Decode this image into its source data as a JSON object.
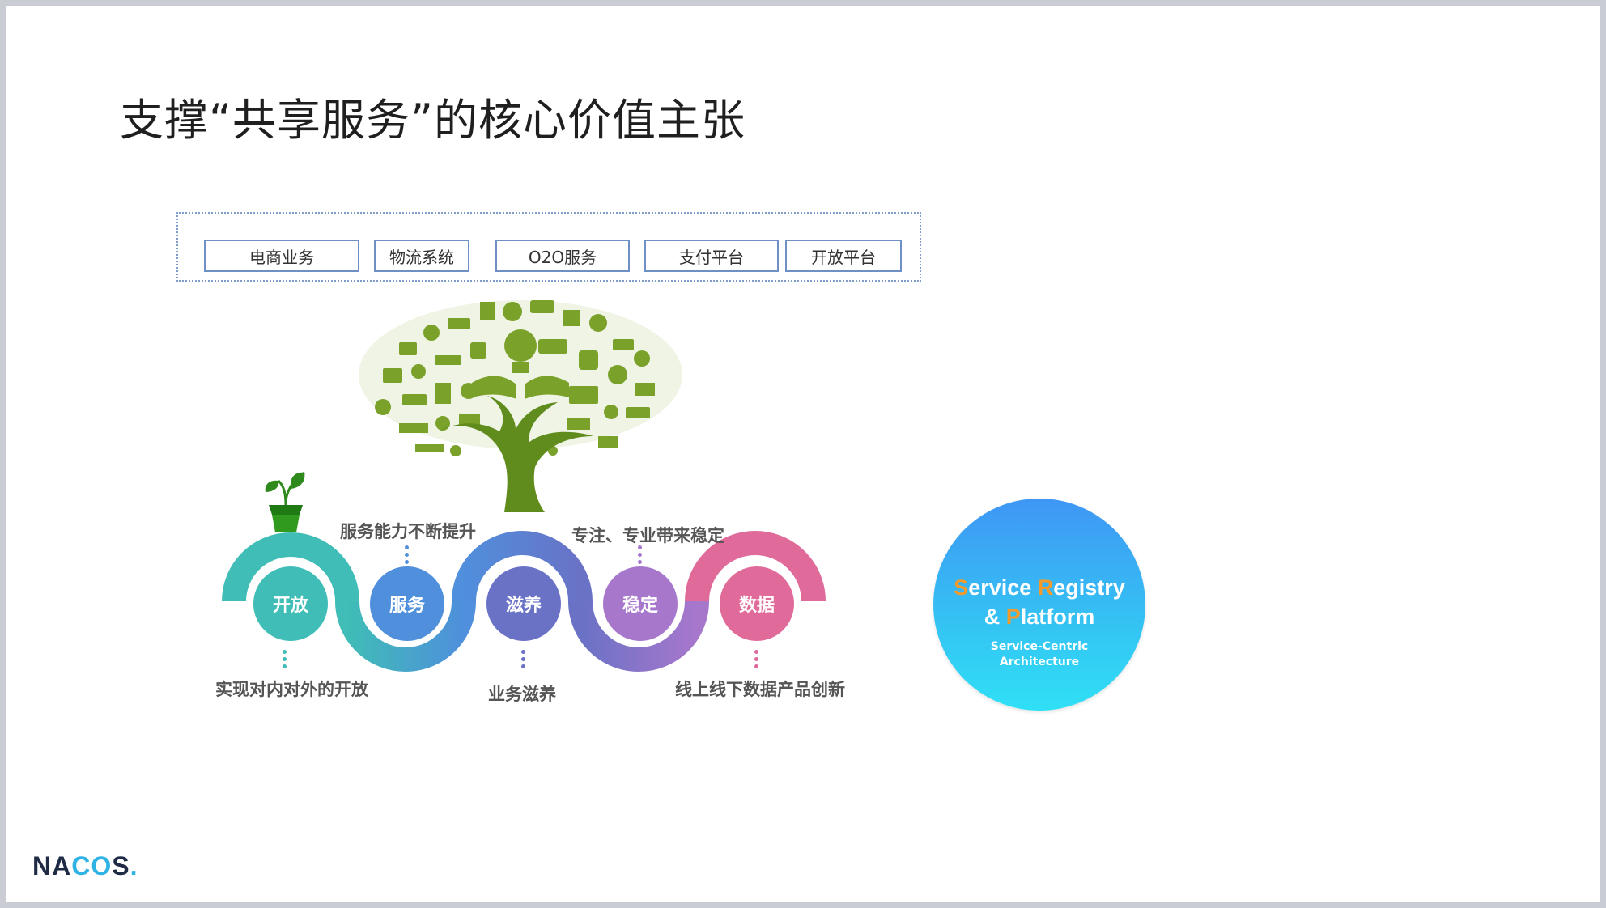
{
  "slide": {
    "title": "支撑“共享服务”的核心价值主张"
  },
  "businesses": [
    "电商业务",
    "物流系统",
    "O2O服务",
    "支付平台",
    "开放平台"
  ],
  "tree": {
    "icon_name": "tree-of-icons",
    "color": "#7aa12a"
  },
  "values": [
    {
      "label": "开放",
      "color": "#3fbdb6",
      "caption": "实现对内对外的开放"
    },
    {
      "label": "服务",
      "color": "#4f8fdc",
      "caption": "服务能力不断提升"
    },
    {
      "label": "滋养",
      "color": "#6a72c6",
      "caption": "业务滋养"
    },
    {
      "label": "稳定",
      "color": "#a777cc",
      "caption": "专注、专业带来稳定"
    },
    {
      "label": "数据",
      "color": "#e06a9a",
      "caption": "线上线下数据产品创新"
    }
  ],
  "sprout": {
    "icon_name": "potted-plant-icon",
    "color": "#2f8a1e"
  },
  "badge": {
    "line1_a_accent": "S",
    "line1_a": "ervice ",
    "line1_b_accent": "R",
    "line1_b": "egistry",
    "line2_a": "& ",
    "line2_b_accent": "P",
    "line2_b": "latform",
    "sub1": "Service-Centric",
    "sub2": "Architecture",
    "accent_color": "#f39a2b"
  },
  "logo": {
    "text_a": "NA",
    "text_mark": "CO",
    "text_b": "S",
    "dot": "."
  }
}
